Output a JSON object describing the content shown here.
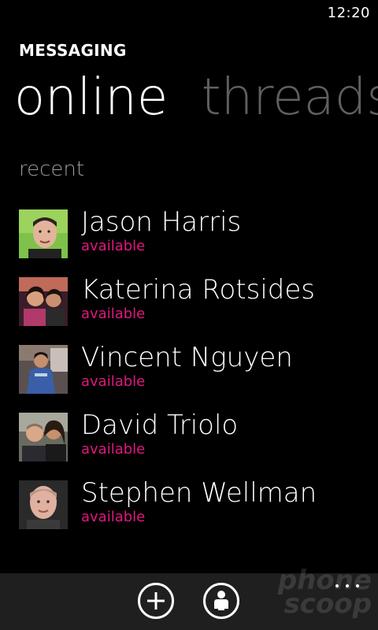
{
  "status_bar": {
    "time": "12:20"
  },
  "app": {
    "title": "MESSAGING"
  },
  "pivot": {
    "active": "online",
    "inactive": "threads"
  },
  "section": {
    "label": "recent"
  },
  "accent_color": "#E0187F",
  "contacts": [
    {
      "name": "Jason Harris",
      "status": "available",
      "avatar": "person-photo"
    },
    {
      "name": "Katerina Rotsides",
      "status": "available",
      "avatar": "person-photo"
    },
    {
      "name": "Vincent Nguyen",
      "status": "available",
      "avatar": "person-photo"
    },
    {
      "name": "David Triolo",
      "status": "available",
      "avatar": "person-photo"
    },
    {
      "name": "Stephen Wellman",
      "status": "available",
      "avatar": "person-photo"
    }
  ],
  "app_bar": {
    "buttons": [
      {
        "icon": "add-icon"
      },
      {
        "icon": "contact-icon"
      }
    ],
    "more_icon": "more-icon"
  },
  "watermark": {
    "line1": "phone",
    "line2": "scoop"
  }
}
